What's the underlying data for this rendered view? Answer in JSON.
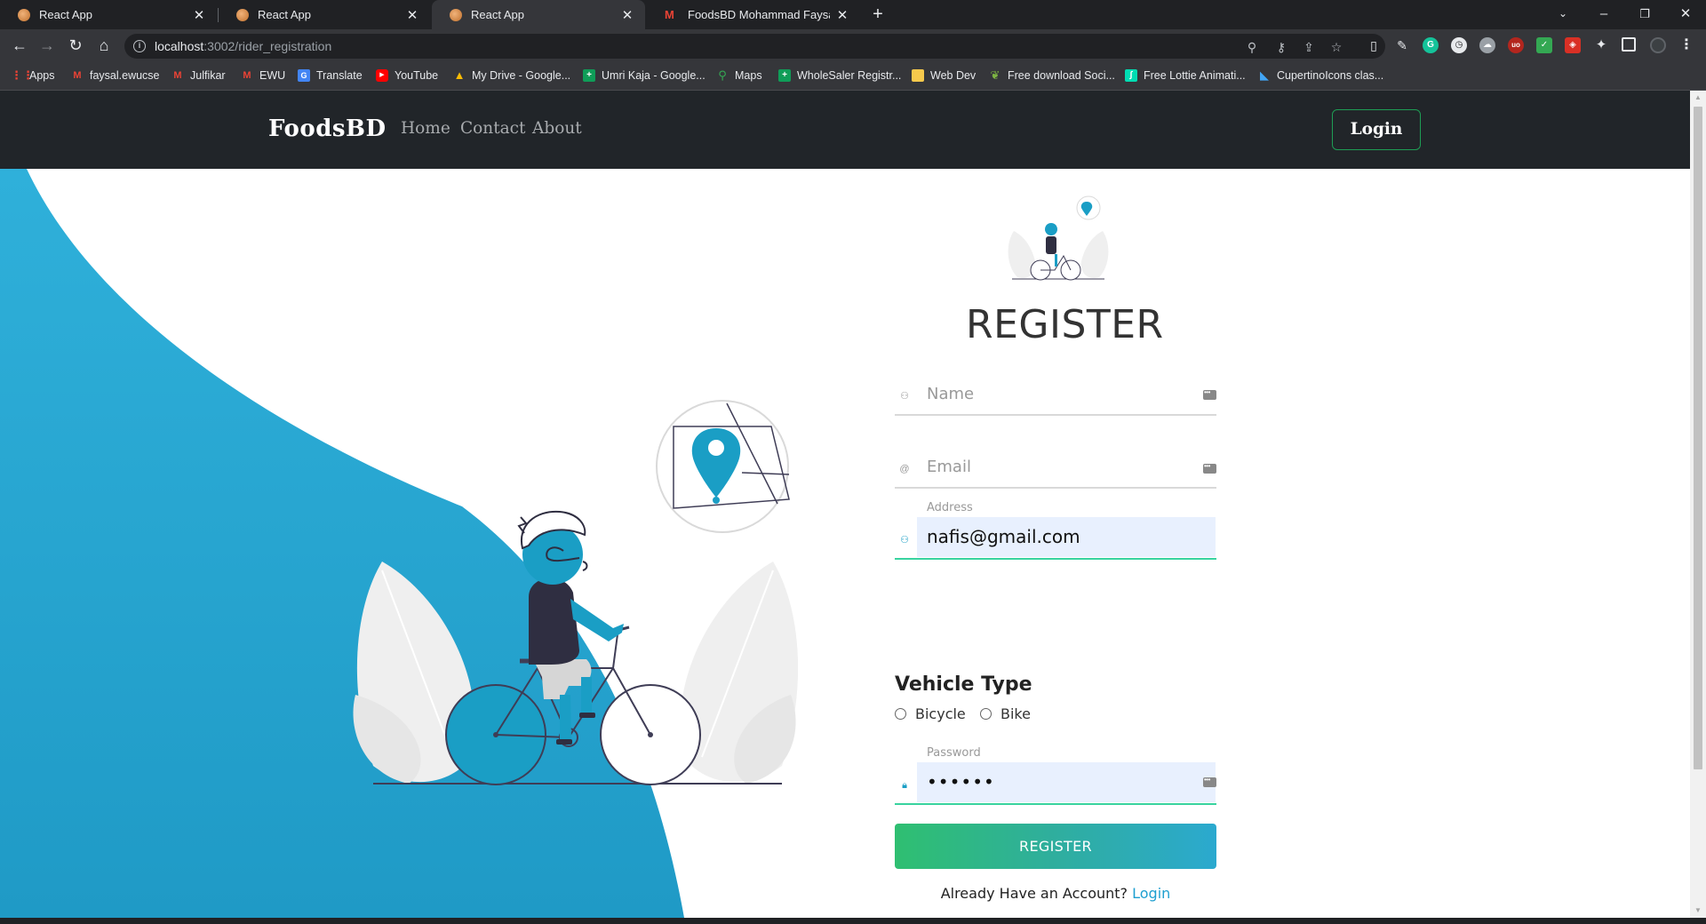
{
  "browser": {
    "tabs": [
      {
        "title": "React App",
        "icon": "react-app-favicon",
        "active": false
      },
      {
        "title": "React App",
        "icon": "react-app-favicon",
        "active": false
      },
      {
        "title": "React App",
        "icon": "react-app-favicon",
        "active": true
      },
      {
        "title": "FoodsBD Mohammad Faysal - fa",
        "icon": "gmail-icon",
        "active": false
      }
    ],
    "url_host": "localhost",
    "url_path": ":3002/rider_registration",
    "bookmarks": [
      {
        "label": "Apps",
        "icon": "apps-grid-icon"
      },
      {
        "label": "faysal.ewucse",
        "icon": "gmail-icon"
      },
      {
        "label": "Julfikar",
        "icon": "gmail-icon"
      },
      {
        "label": "EWU",
        "icon": "gmail-icon"
      },
      {
        "label": "Translate",
        "icon": "translate-icon"
      },
      {
        "label": "YouTube",
        "icon": "youtube-icon"
      },
      {
        "label": "My Drive - Google...",
        "icon": "google-drive-icon"
      },
      {
        "label": "Umri Kaja - Google...",
        "icon": "google-sheets-icon"
      },
      {
        "label": "Maps",
        "icon": "google-maps-icon"
      },
      {
        "label": "WholeSaler Registr...",
        "icon": "google-sheets-icon"
      },
      {
        "label": "Web Dev",
        "icon": "folder-icon"
      },
      {
        "label": "Free download Soci...",
        "icon": "leaf-icon"
      },
      {
        "label": "Free Lottie Animati...",
        "icon": "lottie-icon"
      },
      {
        "label": "CupertinoIcons clas...",
        "icon": "flutter-icon"
      }
    ]
  },
  "navbar": {
    "brand": "FoodsBD",
    "links": [
      "Home",
      "Contact",
      "About"
    ],
    "login": "Login"
  },
  "form": {
    "title": "REGISTER",
    "name_placeholder": "Name",
    "email_placeholder": "Email",
    "address_label": "Address",
    "address_value": "nafis@gmail.com",
    "vehicle_title": "Vehicle Type",
    "vehicle_options": [
      "Bicycle",
      "Bike"
    ],
    "password_label": "Password",
    "password_value": "••••••",
    "submit": "REGISTER",
    "account_text": "Already Have an Account?",
    "account_link": "Login"
  },
  "colors": {
    "accent_blue": "#1f9fcf",
    "accent_green": "#38d39f",
    "navbar_bg": "#212529"
  }
}
